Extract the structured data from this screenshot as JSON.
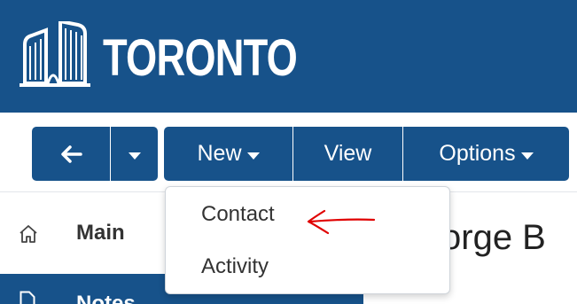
{
  "header": {
    "logo_text": "TORONTO",
    "logo_icon": "city-hall-icon",
    "background": "#17528a"
  },
  "toolbar": {
    "back_icon": "arrow-left-icon",
    "back_caret_icon": "caret-down-icon",
    "new_label": "New",
    "view_label": "View",
    "options_label": "Options",
    "button_color": "#17528a"
  },
  "nav": {
    "main_label": "Main",
    "main_icon": "home-icon",
    "notes_label": "Notes",
    "notes_icon": "document-icon"
  },
  "record": {
    "title_fragment": "orge B"
  },
  "new_menu": {
    "items": [
      {
        "label": "Contact"
      },
      {
        "label": "Activity"
      }
    ]
  },
  "annotation": {
    "type": "arrow",
    "color": "#e00000"
  }
}
